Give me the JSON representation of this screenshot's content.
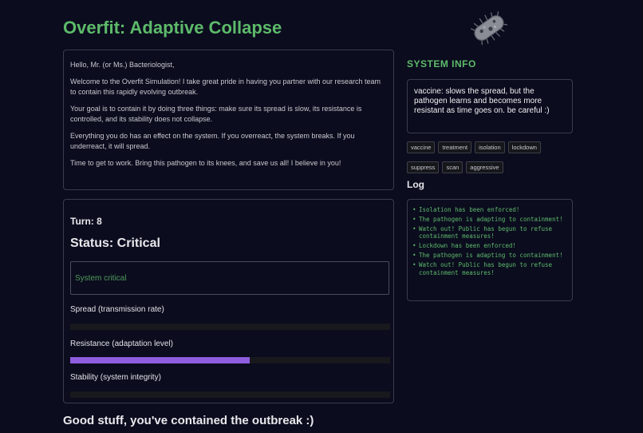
{
  "title": "Overfit: Adaptive Collapse",
  "intro": {
    "greeting": "Hello, Mr. (or Ms.) Bacteriologist,",
    "p1": "Welcome to the Overfit Simulation! I take great pride in having you partner with our research team to contain this rapidly evolving outbreak.",
    "p2": "Your goal is to contain it by doing three things: make sure its spread is slow, its resistance is controlled, and its stability does not collapse.",
    "p3": "Everything you do has an effect on the system. If you overreact, the system breaks. If you underreact, it will spread.",
    "p4": "Time to get to work. Bring this pathogen to its knees, and save us all! I believe in you!"
  },
  "game": {
    "turn": "Turn: 8",
    "status": "Status: Critical",
    "alert": "System critical",
    "meters": [
      {
        "label": "Spread (transmission rate)",
        "value": 0
      },
      {
        "label": "Resistance (adaptation level)",
        "value": 56
      },
      {
        "label": "Stability (system integrity)",
        "value": 0
      }
    ],
    "meter_color": "#8f5de0"
  },
  "final_message": "Good stuff, you've contained the outbreak :)",
  "system_info": {
    "title": "SYSTEM INFO",
    "text": "vaccine: slows the spread, but the pathogen learns and becomes more resistant as time goes on. be careful :)"
  },
  "commands": [
    "vaccine",
    "treatment",
    "isolation",
    "lockdown",
    "suppress",
    "scan",
    "aggressive"
  ],
  "log": {
    "title": "Log",
    "entries": [
      "Isolation has been enforced!",
      "The pathogen is adapting to containment!",
      "Watch out! Public has begun to refuse containment measures!",
      "Lockdown has been enforced!",
      "The pathogen is adapting to containment!",
      "Watch out! Public has begun to refuse containment measures!"
    ]
  },
  "colors": {
    "accent": "#5dba6a",
    "background": "#0b0c1e",
    "log_text": "#5dba6a"
  }
}
